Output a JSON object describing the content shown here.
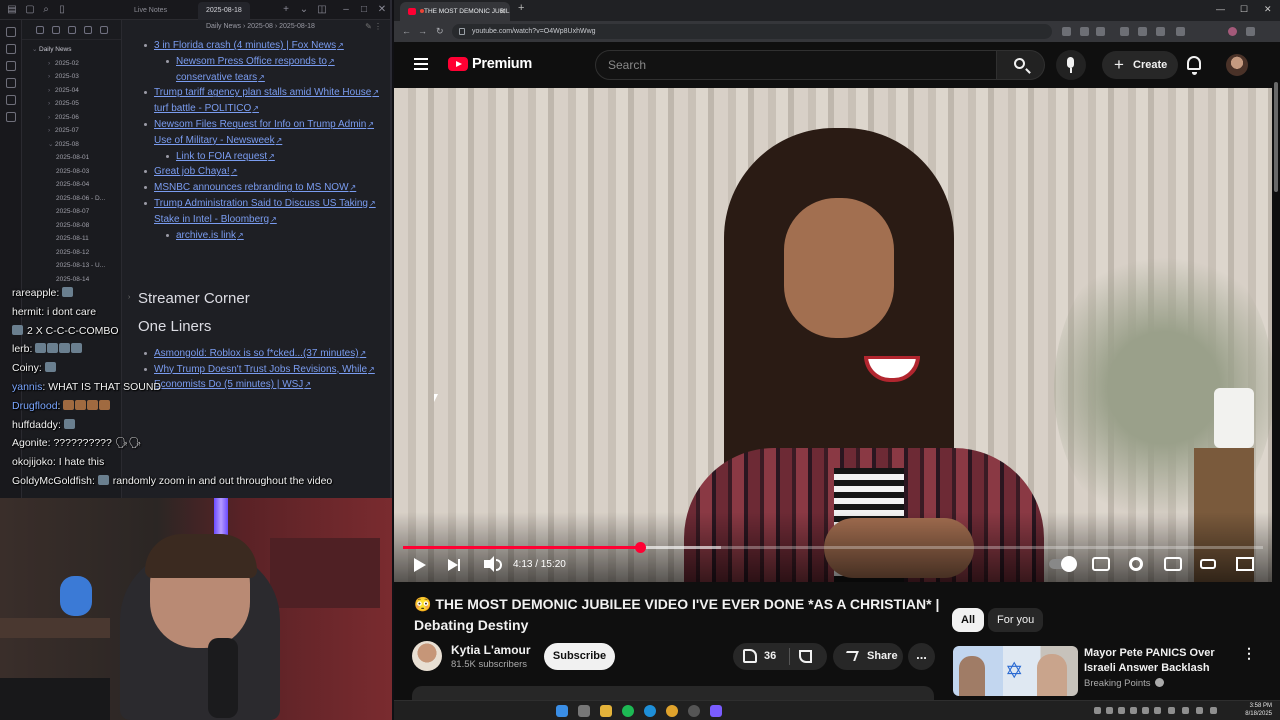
{
  "obsidian": {
    "pane_title": "Live Notes",
    "tab_active": "2025-08-18",
    "breadcrumb": "Daily News › 2025-08 › 2025-08-18",
    "tree": [
      {
        "label": "Daily News",
        "level": 0
      },
      {
        "label": "2025-02",
        "level": 1
      },
      {
        "label": "2025-03",
        "level": 1
      },
      {
        "label": "2025-04",
        "level": 1
      },
      {
        "label": "2025-05",
        "level": 1
      },
      {
        "label": "2025-06",
        "level": 1
      },
      {
        "label": "2025-07",
        "level": 1
      },
      {
        "label": "2025-08",
        "level": 1
      },
      {
        "label": "2025-08-01",
        "level": 2
      },
      {
        "label": "2025-08-03",
        "level": 2
      },
      {
        "label": "2025-08-04",
        "level": 2
      },
      {
        "label": "2025-08-06 - D...",
        "level": 2
      },
      {
        "label": "2025-08-07",
        "level": 2
      },
      {
        "label": "2025-08-08",
        "level": 2
      },
      {
        "label": "2025-08-11",
        "level": 2
      },
      {
        "label": "2025-08-12",
        "level": 2
      },
      {
        "label": "2025-08-13 - U...",
        "level": 2
      },
      {
        "label": "2025-08-14",
        "level": 2
      }
    ],
    "note_links": [
      {
        "text": "3 in Florida crash (4 minutes) | Fox News",
        "indent": 1
      },
      {
        "text": "Newsom Press Office responds to",
        "indent": 2
      },
      {
        "text": "conservative tears",
        "indent": 2,
        "cont": true
      },
      {
        "text": "Trump tariff agency plan stalls amid White House",
        "indent": 1
      },
      {
        "text": "turf battle - POLITICO",
        "indent": 1,
        "cont": true
      },
      {
        "text": "Newsom Files Request for Info on Trump Admin",
        "indent": 1
      },
      {
        "text": "Use of Military - Newsweek",
        "indent": 1,
        "cont": true
      },
      {
        "text": "Link to FOIA request",
        "indent": 2
      },
      {
        "text": "Great job Chaya!",
        "indent": 1
      },
      {
        "text": "MSNBC announces rebranding to MS NOW",
        "indent": 1
      },
      {
        "text": "Trump Administration Said to Discuss US Taking",
        "indent": 1
      },
      {
        "text": "Stake in Intel - Bloomberg",
        "indent": 1,
        "cont": true
      },
      {
        "text": "archive.is link",
        "indent": 2
      }
    ],
    "heading_streamer": "Streamer Corner",
    "heading_one_liners": "One Liners",
    "one_liner_links": [
      {
        "text": "Asmongold: Roblox is so f*cked...(37 minutes)",
        "cont": false
      },
      {
        "text": "Why Trump Doesn't Trust Jobs Revisions, While",
        "cont": false
      },
      {
        "text": "Economists Do (5 minutes) | WSJ",
        "cont": true
      }
    ],
    "link_color": "#7a9cf0"
  },
  "chat": [
    {
      "user": "rareapple",
      "msg": "",
      "emotes": 1
    },
    {
      "user": "hermit",
      "msg": "i dont care",
      "emotes": 0
    },
    {
      "user": "",
      "msg": "2 X C-C-C-COMBO",
      "emotes": 1
    },
    {
      "user": "lerb",
      "msg": "",
      "emotes": 4
    },
    {
      "user": "Coiny",
      "msg": "",
      "emotes": 1
    },
    {
      "user": "yannis",
      "msg": "WHAT IS THAT SOUND",
      "emotes": 0,
      "blue": true
    },
    {
      "user": "Drugflood",
      "msg": "",
      "emotes": 4,
      "blue": true
    },
    {
      "user": "huffdaddy",
      "msg": "",
      "emotes": 1
    },
    {
      "user": "Agonite",
      "msg": "?????????? 🗣🗣",
      "emotes": 0
    },
    {
      "user": "okojijoko",
      "msg": "I hate this",
      "emotes": 0
    },
    {
      "user": "GoldyMcGoldfish",
      "msg": "randomly zoom in and out throughout the video",
      "emotes": 1
    }
  ],
  "browser": {
    "tab_title": "THE MOST DEMONIC JUBIL",
    "url": "youtube.com/watch?v=O4Wp8UxhWwg",
    "new_tab": "+",
    "win_min": "—",
    "win_max": "☐",
    "win_close": "✕"
  },
  "youtube": {
    "brand": "Premium",
    "search_placeholder": "Search",
    "create_label": "Create",
    "time_display": "4:13 / 15:20",
    "progress_played": 0.275,
    "progress_buffered": 0.37,
    "video_title": "😳 THE MOST DEMONIC JUBILEE VIDEO I'VE EVER DONE *AS A CHRISTIAN* | Debating Destiny",
    "channel_name": "Kytia L'amour",
    "subscribers": "81.5K subscribers",
    "subscribe_label": "Subscribe",
    "like_count": "36",
    "share_label": "Share",
    "more_label": "...",
    "chips": [
      "All",
      "For you"
    ],
    "recommended": {
      "title": "Mayor Pete PANICS Over Israeli Answer Backlash",
      "channel": "Breaking Points",
      "more": "⋮"
    },
    "accent": "#ff0033"
  },
  "taskbar": {
    "time": "3:58 PM",
    "date": "8/18/2025"
  }
}
